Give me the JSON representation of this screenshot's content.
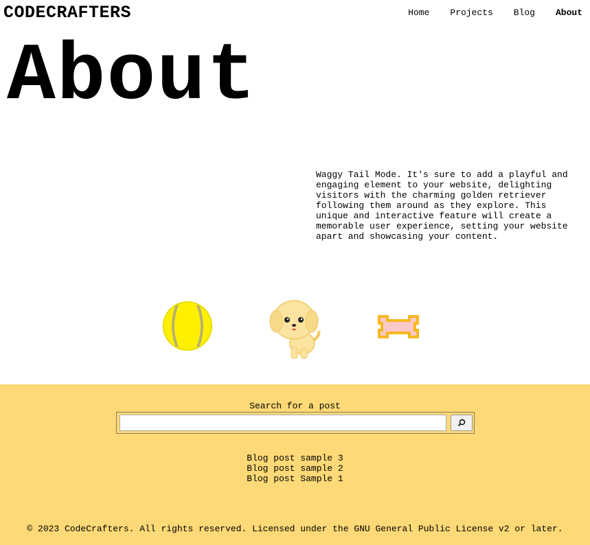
{
  "header": {
    "brand": "CODECRAFTERS",
    "nav": [
      {
        "label": "Home",
        "active": false
      },
      {
        "label": "Projects",
        "active": false
      },
      {
        "label": "Blog",
        "active": false
      },
      {
        "label": "About",
        "active": true
      }
    ]
  },
  "main": {
    "title": "About",
    "description": "Waggy Tail Mode. It's sure to add a playful and engaging element to your website, delighting visitors with the charming golden retriever following them around as they explore. This unique and interactive feature will create a memorable user experience, setting your website apart and showcasing your content.",
    "pets": [
      {
        "icon": "tennis-ball-icon"
      },
      {
        "icon": "golden-retriever-puppy-icon"
      },
      {
        "icon": "dog-bone-icon"
      }
    ]
  },
  "footer": {
    "background": "#fdd977",
    "search_label": "Search for a post",
    "search_placeholder": "",
    "search_button_icon": "search-icon",
    "posts": [
      "Blog post sample 3",
      "Blog post sample 2",
      "Blog post Sample 1"
    ],
    "copyright": "© 2023 CodeCrafters. All rights reserved. Licensed under the GNU General Public License v2 or later."
  }
}
